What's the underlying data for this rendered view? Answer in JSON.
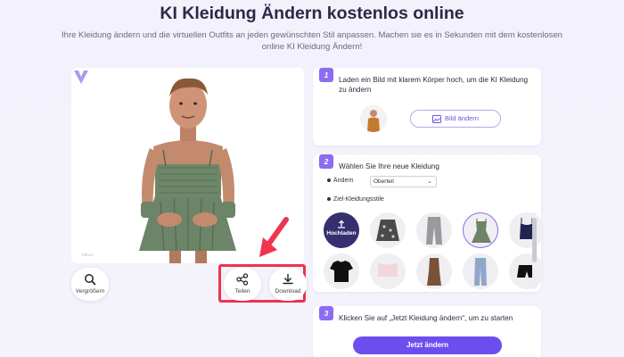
{
  "page": {
    "title": "KI Kleidung Ändern kostenlos online",
    "subtitle": "Ihre Kleidung ändern und die virtuellen Outfits an jeden gewünschten Stil anpassen. Machen sie es in Sekunden mit dem kostenlosen online KI Kleidung Ändern!"
  },
  "preview": {
    "watermark_label": "Vidnoz",
    "zoom_label": "Vergrößern",
    "share_label": "Teilen",
    "download_label": "Download"
  },
  "step1": {
    "number": "1",
    "text": "Laden ein Bild mit klarem Körper hoch, um die KI Kleidung zu ändern",
    "change_image_label": "Bild ändern"
  },
  "step2": {
    "number": "2",
    "text": "Wählen Sie Ihre neue Kleidung",
    "change_label": "Ändern",
    "select_value": "Oberteil",
    "styles_label": "Ziel-Kleidungsstile",
    "upload_label": "Hochladen",
    "items": [
      "floral-skirt",
      "grey-jeans",
      "green-dress",
      "navy-top",
      "black-tshirt",
      "pink-top",
      "brown-dress",
      "blue-jeans",
      "black-shorts"
    ]
  },
  "step3": {
    "number": "3",
    "text": "Klicken Sie auf „Jetzt Kleidung ändern“, um zu starten",
    "cta_label": "Jetzt ändern"
  },
  "colors": {
    "accent": "#6c4ef0",
    "highlight": "#f0334e",
    "upload_bg": "#362f6f"
  }
}
